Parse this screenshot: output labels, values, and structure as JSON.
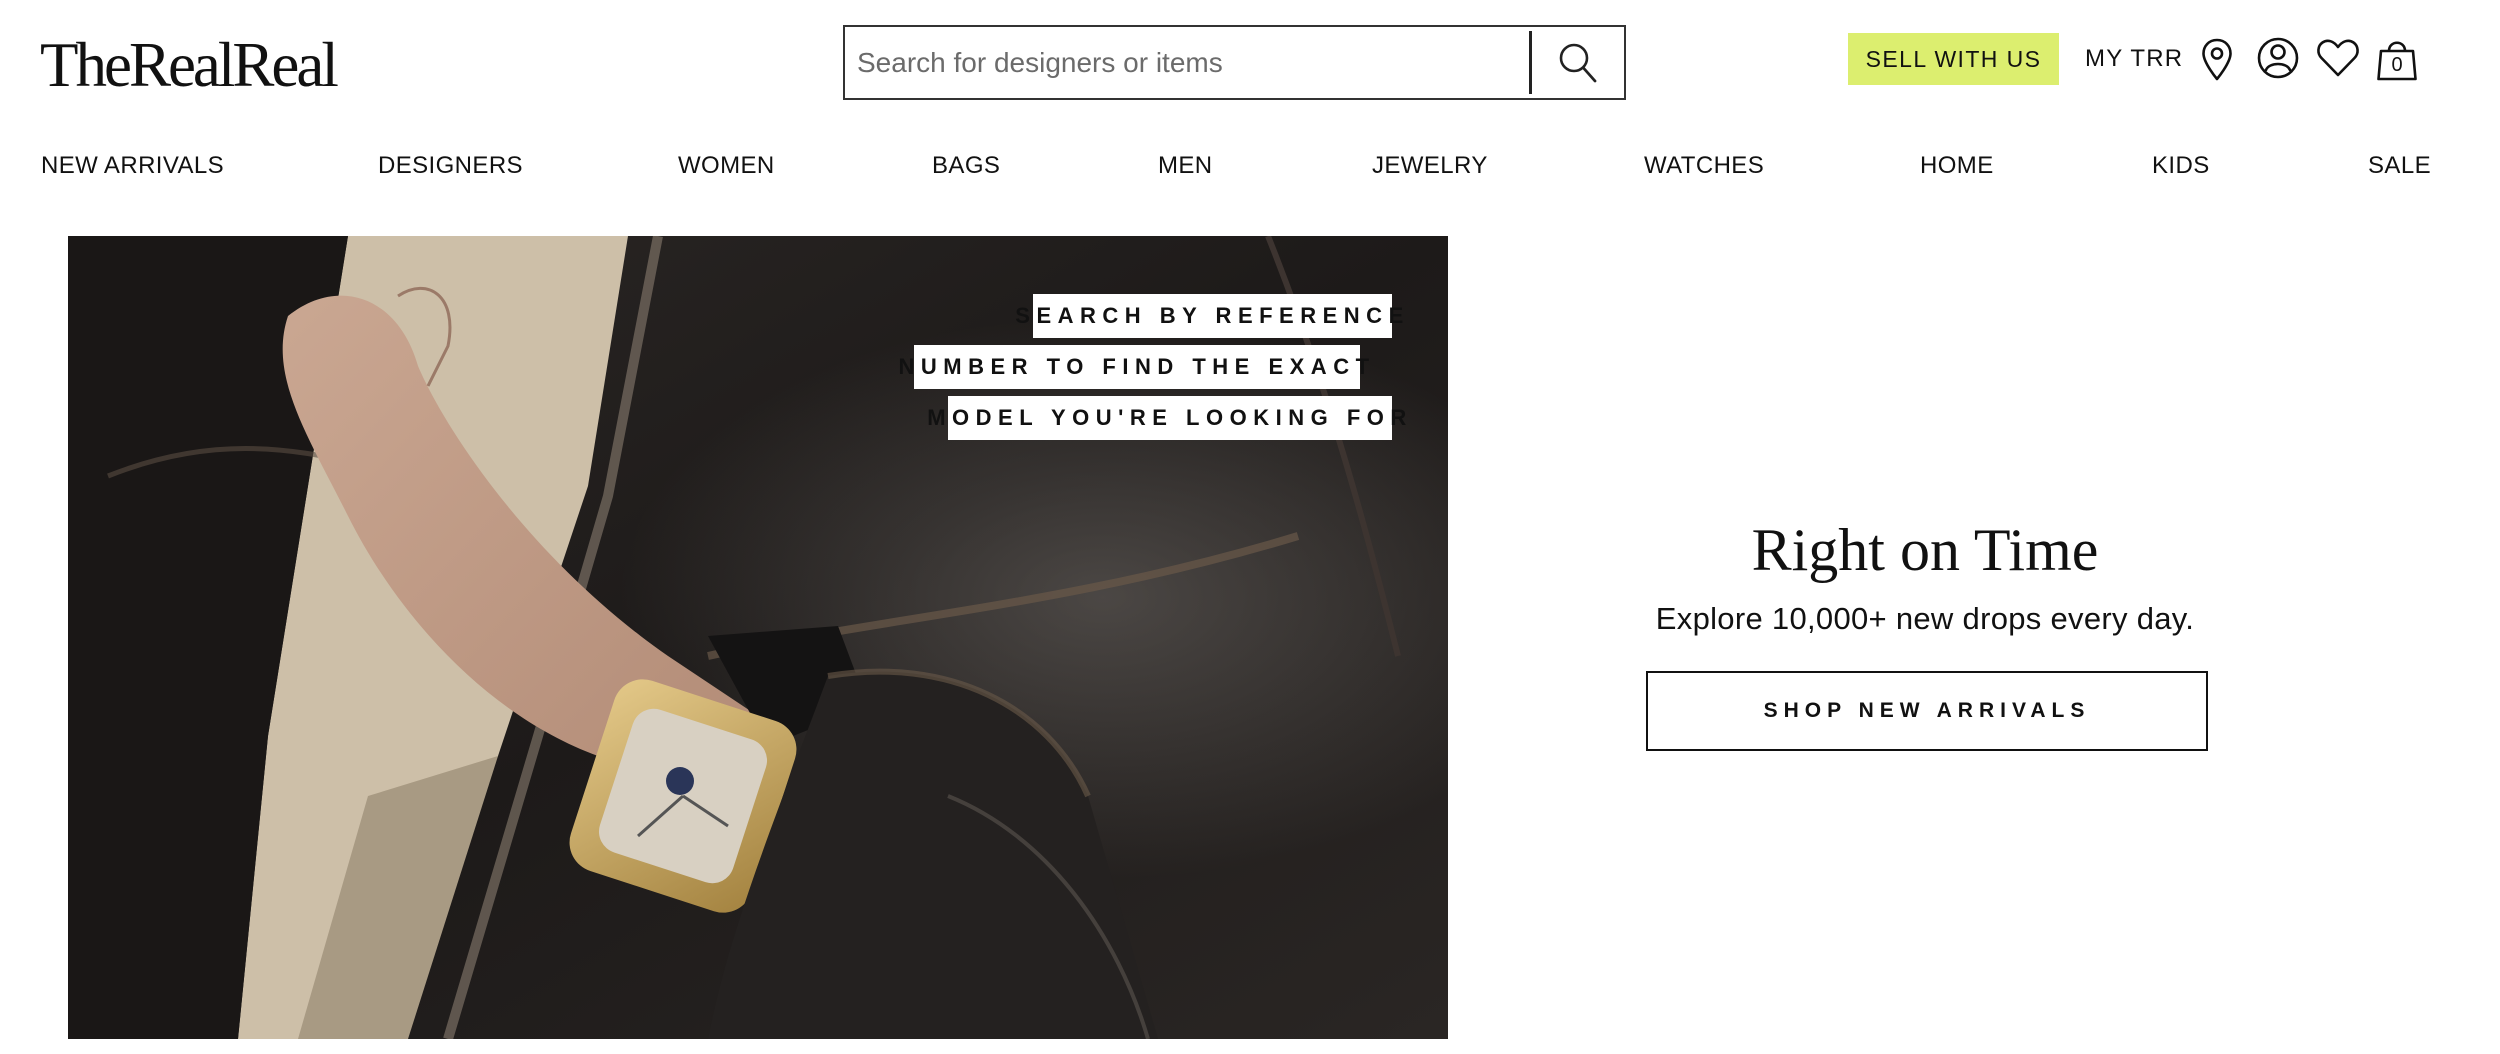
{
  "brand": {
    "logo_text": "TheRealReal"
  },
  "search": {
    "placeholder": "Search for designers or items",
    "value": ""
  },
  "header": {
    "sell_label": "SELL WITH US",
    "sell_bg": "#dcee6f",
    "mytrr_label": "MY TRR",
    "cart_count": "0",
    "icons": [
      "location-pin-icon",
      "account-icon",
      "heart-icon",
      "shopping-bag-icon"
    ]
  },
  "nav": {
    "items": [
      "NEW ARRIVALS",
      "DESIGNERS",
      "WOMEN",
      "BAGS",
      "MEN",
      "JEWELRY",
      "WATCHES",
      "HOME",
      "KIDS",
      "SALE"
    ]
  },
  "hero": {
    "tag_lines": [
      "SEARCH BY REFERENCE",
      "NUMBER TO FIND THE EXACT",
      "MODEL YOU'RE LOOKING FOR"
    ]
  },
  "promo": {
    "title": "Right on Time",
    "subtitle": "Explore 10,000+ new drops every day.",
    "cta_label": "SHOP NEW ARRIVALS"
  }
}
